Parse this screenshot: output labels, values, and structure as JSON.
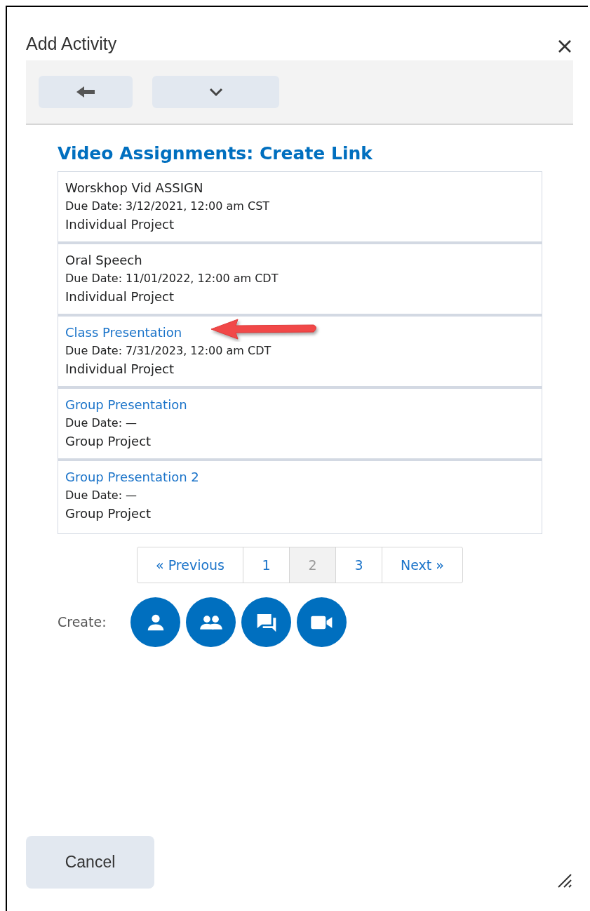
{
  "dialog": {
    "title": "Add Activity"
  },
  "heading": "Video Assignments: Create Link",
  "assignments": [
    {
      "title": "Worskhop Vid ASSIGN",
      "linked": false,
      "due": "Due Date: 3/12/2021, 12:00 am CST",
      "type": "Individual Project"
    },
    {
      "title": "Oral Speech",
      "linked": false,
      "due": "Due Date: 11/01/2022, 12:00 am CDT",
      "type": "Individual Project"
    },
    {
      "title": "Class Presentation",
      "linked": true,
      "due": "Due Date: 7/31/2023, 12:00 am CDT",
      "type": "Individual Project"
    },
    {
      "title": "Group Presentation",
      "linked": true,
      "due": "Due Date: —",
      "type": "Group Project"
    },
    {
      "title": "Group Presentation 2",
      "linked": true,
      "due": "Due Date: —",
      "type": "Group Project"
    }
  ],
  "pagination": {
    "previous": "« Previous",
    "next": "Next »",
    "pages": [
      {
        "label": "1",
        "selected": false
      },
      {
        "label": "2",
        "selected": true
      },
      {
        "label": "3",
        "selected": false
      }
    ]
  },
  "create": {
    "label": "Create:",
    "buttons": [
      {
        "kind": "person"
      },
      {
        "kind": "group"
      },
      {
        "kind": "discussion"
      },
      {
        "kind": "video"
      }
    ]
  },
  "cancel": "Cancel"
}
